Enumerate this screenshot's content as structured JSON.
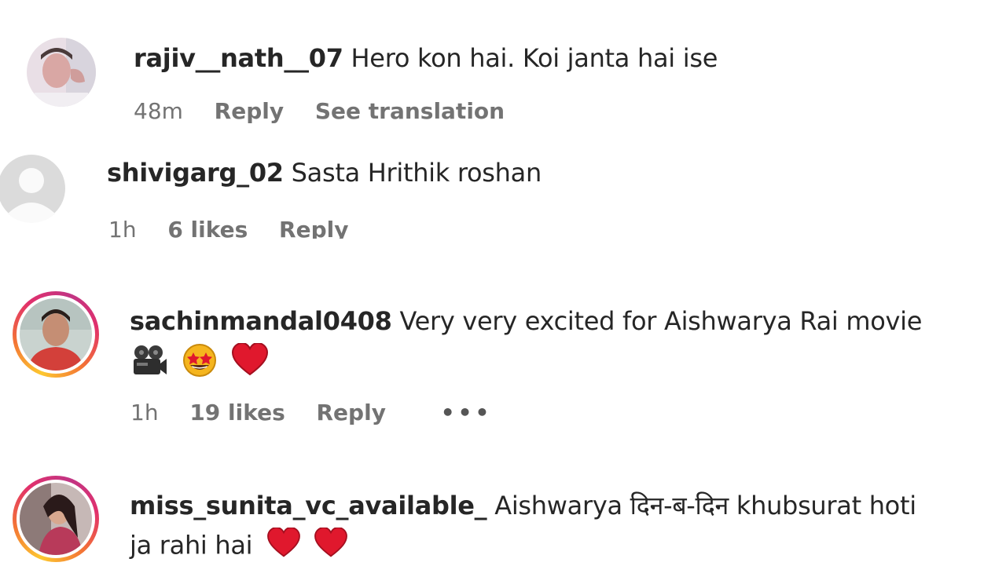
{
  "comments": [
    {
      "username": "rajiv__nath__07",
      "text": "Hero kon hai. Koi janta hai ise",
      "time": "48m",
      "reply": "Reply",
      "translate": "See translation"
    },
    {
      "username": "shivigarg_02",
      "text": "Sasta Hrithik roshan",
      "time": "1h",
      "likes": "6 likes",
      "reply": "Reply"
    },
    {
      "username": "sachinmandal0408",
      "text": "Very very excited for Aishwarya Rai movie",
      "emoji_line": [
        "movie-camera-icon",
        "star-struck-icon",
        "red-heart-icon"
      ],
      "time": "1h",
      "likes": "19 likes",
      "reply": "Reply",
      "more": "•••"
    },
    {
      "username": "miss_sunita_vc_available_",
      "text": "Aishwarya दिन-ब-दिन khubsurat hoti",
      "text_line2": "ja rahi hai",
      "emoji_line": [
        "red-heart-icon",
        "red-heart-icon"
      ]
    }
  ],
  "colors": {
    "username": "#262626",
    "meta": "#737373",
    "story_ring_start": "#fdc830",
    "story_ring_end": "#c13584",
    "heart": "#e0182d"
  }
}
